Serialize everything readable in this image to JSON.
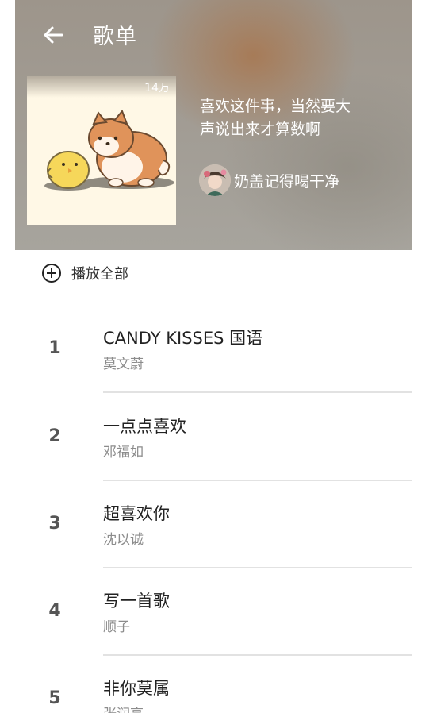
{
  "header": {
    "title": "歌单",
    "play_count": "14万",
    "description_line1": "喜欢这件事，当然要大",
    "description_line2": "声说出来才算数啊",
    "creator_name": "奶盖记得喝干净"
  },
  "actions": {
    "play_all_label": "播放全部"
  },
  "songs": [
    {
      "index": "1",
      "title": "CANDY KISSES 国语",
      "artist": "莫文蔚"
    },
    {
      "index": "2",
      "title": "一点点喜欢",
      "artist": "邓福如"
    },
    {
      "index": "3",
      "title": "超喜欢你",
      "artist": "沈以诚"
    },
    {
      "index": "4",
      "title": "写一首歌",
      "artist": "顺子"
    },
    {
      "index": "5",
      "title": "非你莫属",
      "artist": "张润亮"
    }
  ],
  "colors": {
    "header_bg": "#a29d95",
    "accent_brown": "#a8764e",
    "text_primary": "#222222",
    "text_secondary": "#8c8c8c"
  }
}
